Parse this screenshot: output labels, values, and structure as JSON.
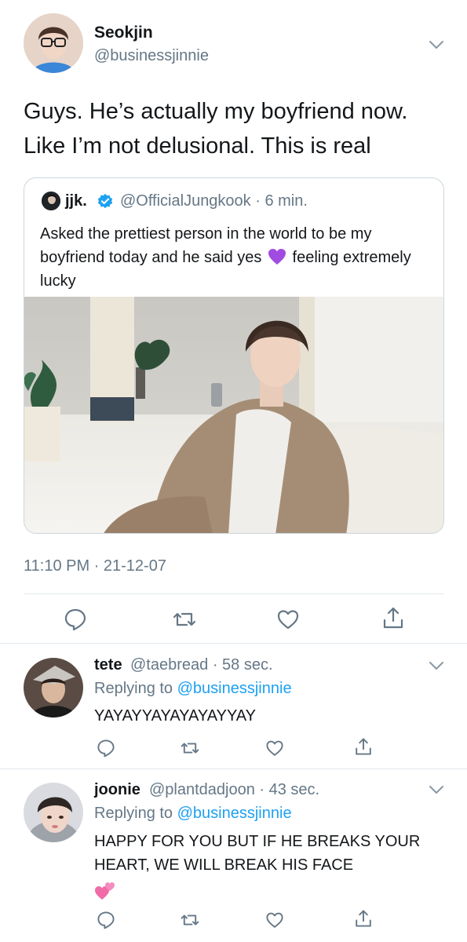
{
  "main_tweet": {
    "display_name": "Seokjin",
    "handle": "@businessjinnie",
    "text": "Guys. He’s actually my boyfriend now. Like I’m not delusional. This is real",
    "timestamp": "11:10 PM · 21-12-07"
  },
  "quoted_tweet": {
    "display_name": "jjk.",
    "verified": true,
    "meta": "@OfficialJungkook · 6 min.",
    "text_before_emoji": "Asked the prettiest person in the world to be my boyfriend today and he said yes",
    "emoji": "purple-heart",
    "text_after_emoji": "feeling extremely lucky"
  },
  "replies": [
    {
      "display_name": "tete",
      "meta": "@taebread · 58 sec.",
      "replying_prefix": "Replying to",
      "replying_to": "@businessjinnie",
      "text": "YAYAYYAYAYAYAYYAY"
    },
    {
      "display_name": "joonie",
      "meta": "@plantdadjoon · 43 sec.",
      "replying_prefix": "Replying to",
      "replying_to": "@businessjinnie",
      "text": "HAPPY FOR YOU BUT IF HE BREAKS YOUR HEART, WE WILL BREAK HIS FACE",
      "emoji": "two-hearts"
    }
  ],
  "colors": {
    "text": "#14171a",
    "secondary": "#657786",
    "link": "#1da1f2",
    "divider": "#e1e8ed",
    "verified": "#1da1f2"
  },
  "icons": [
    "reply-icon",
    "retweet-icon",
    "like-icon",
    "share-icon",
    "chevron-down-icon",
    "verified-badge-icon"
  ]
}
